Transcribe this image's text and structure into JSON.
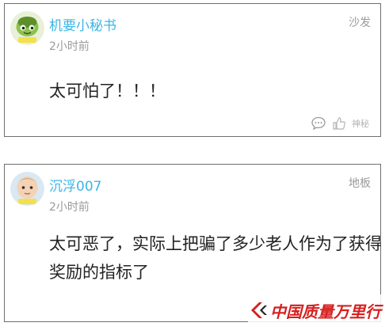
{
  "comments": [
    {
      "username": "机要小秘书",
      "time": "2小时前",
      "rank": "沙发",
      "text": "太可怕了！！！",
      "like_label": "神秘"
    },
    {
      "username": "沉浮007",
      "time": "2小时前",
      "rank": "地板",
      "text": "太可恶了，实际上把骗了多少老人作为了获得奖励的指标了"
    }
  ],
  "watermark": {
    "text": "中国质量万里行"
  },
  "colors": {
    "username": "#3bb6e6",
    "muted": "#9a9a9a",
    "border": "#6f6f6f",
    "watermark": "#d61f1f"
  }
}
